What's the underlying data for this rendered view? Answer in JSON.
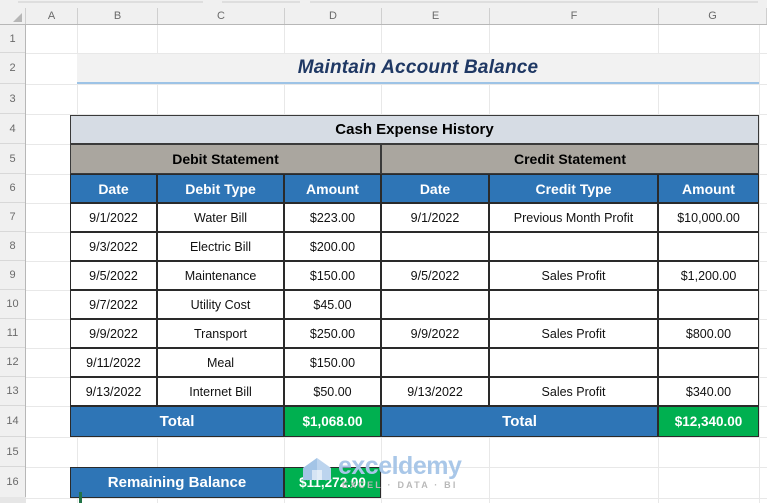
{
  "spreadsheet": {
    "column_headers": [
      "A",
      "B",
      "C",
      "D",
      "E",
      "F",
      "G"
    ],
    "row_headers": [
      "1",
      "2",
      "3",
      "4",
      "5",
      "6",
      "7",
      "8",
      "9",
      "10",
      "11",
      "12",
      "13",
      "14",
      "15",
      "16"
    ]
  },
  "title": "Maintain Account Balance",
  "table": {
    "caption": "Cash Expense History",
    "groups": [
      {
        "label": "Debit Statement"
      },
      {
        "label": "Credit Statement"
      }
    ],
    "columns": [
      "Date",
      "Debit Type",
      "Amount",
      "Date",
      "Credit Type",
      "Amount"
    ],
    "rows": [
      {
        "debit_date": "9/1/2022",
        "debit_type": "Water Bill",
        "debit_amount": "$223.00",
        "credit_date": "9/1/2022",
        "credit_type": "Previous Month Profit",
        "credit_amount": "$10,000.00"
      },
      {
        "debit_date": "9/3/2022",
        "debit_type": "Electric Bill",
        "debit_amount": "$200.00",
        "credit_date": "",
        "credit_type": "",
        "credit_amount": ""
      },
      {
        "debit_date": "9/5/2022",
        "debit_type": "Maintenance",
        "debit_amount": "$150.00",
        "credit_date": "9/5/2022",
        "credit_type": "Sales Profit",
        "credit_amount": "$1,200.00"
      },
      {
        "debit_date": "9/7/2022",
        "debit_type": "Utility Cost",
        "debit_amount": "$45.00",
        "credit_date": "",
        "credit_type": "",
        "credit_amount": ""
      },
      {
        "debit_date": "9/9/2022",
        "debit_type": "Transport",
        "debit_amount": "$250.00",
        "credit_date": "9/9/2022",
        "credit_type": "Sales Profit",
        "credit_amount": "$800.00"
      },
      {
        "debit_date": "9/11/2022",
        "debit_type": "Meal",
        "debit_amount": "$150.00",
        "credit_date": "",
        "credit_type": "",
        "credit_amount": ""
      },
      {
        "debit_date": "9/13/2022",
        "debit_type": "Internet Bill",
        "debit_amount": "$50.00",
        "credit_date": "9/13/2022",
        "credit_type": "Sales Profit",
        "credit_amount": "$340.00"
      }
    ],
    "totals": {
      "debit_label": "Total",
      "debit_value": "$1,068.00",
      "credit_label": "Total",
      "credit_value": "$12,340.00"
    }
  },
  "summary": {
    "label": "Remaining Balance",
    "value": "$11,272.00"
  },
  "watermark": {
    "brand": "exceldemy",
    "tagline": "EXCEL · DATA · BI"
  },
  "colors": {
    "header_blue": "#2e75b6",
    "total_green": "#00b050",
    "group_gray": "#aaa69f",
    "caption_bluegray": "#d6dce4",
    "title_text": "#1f3864",
    "title_rule": "#9dc3e6"
  }
}
